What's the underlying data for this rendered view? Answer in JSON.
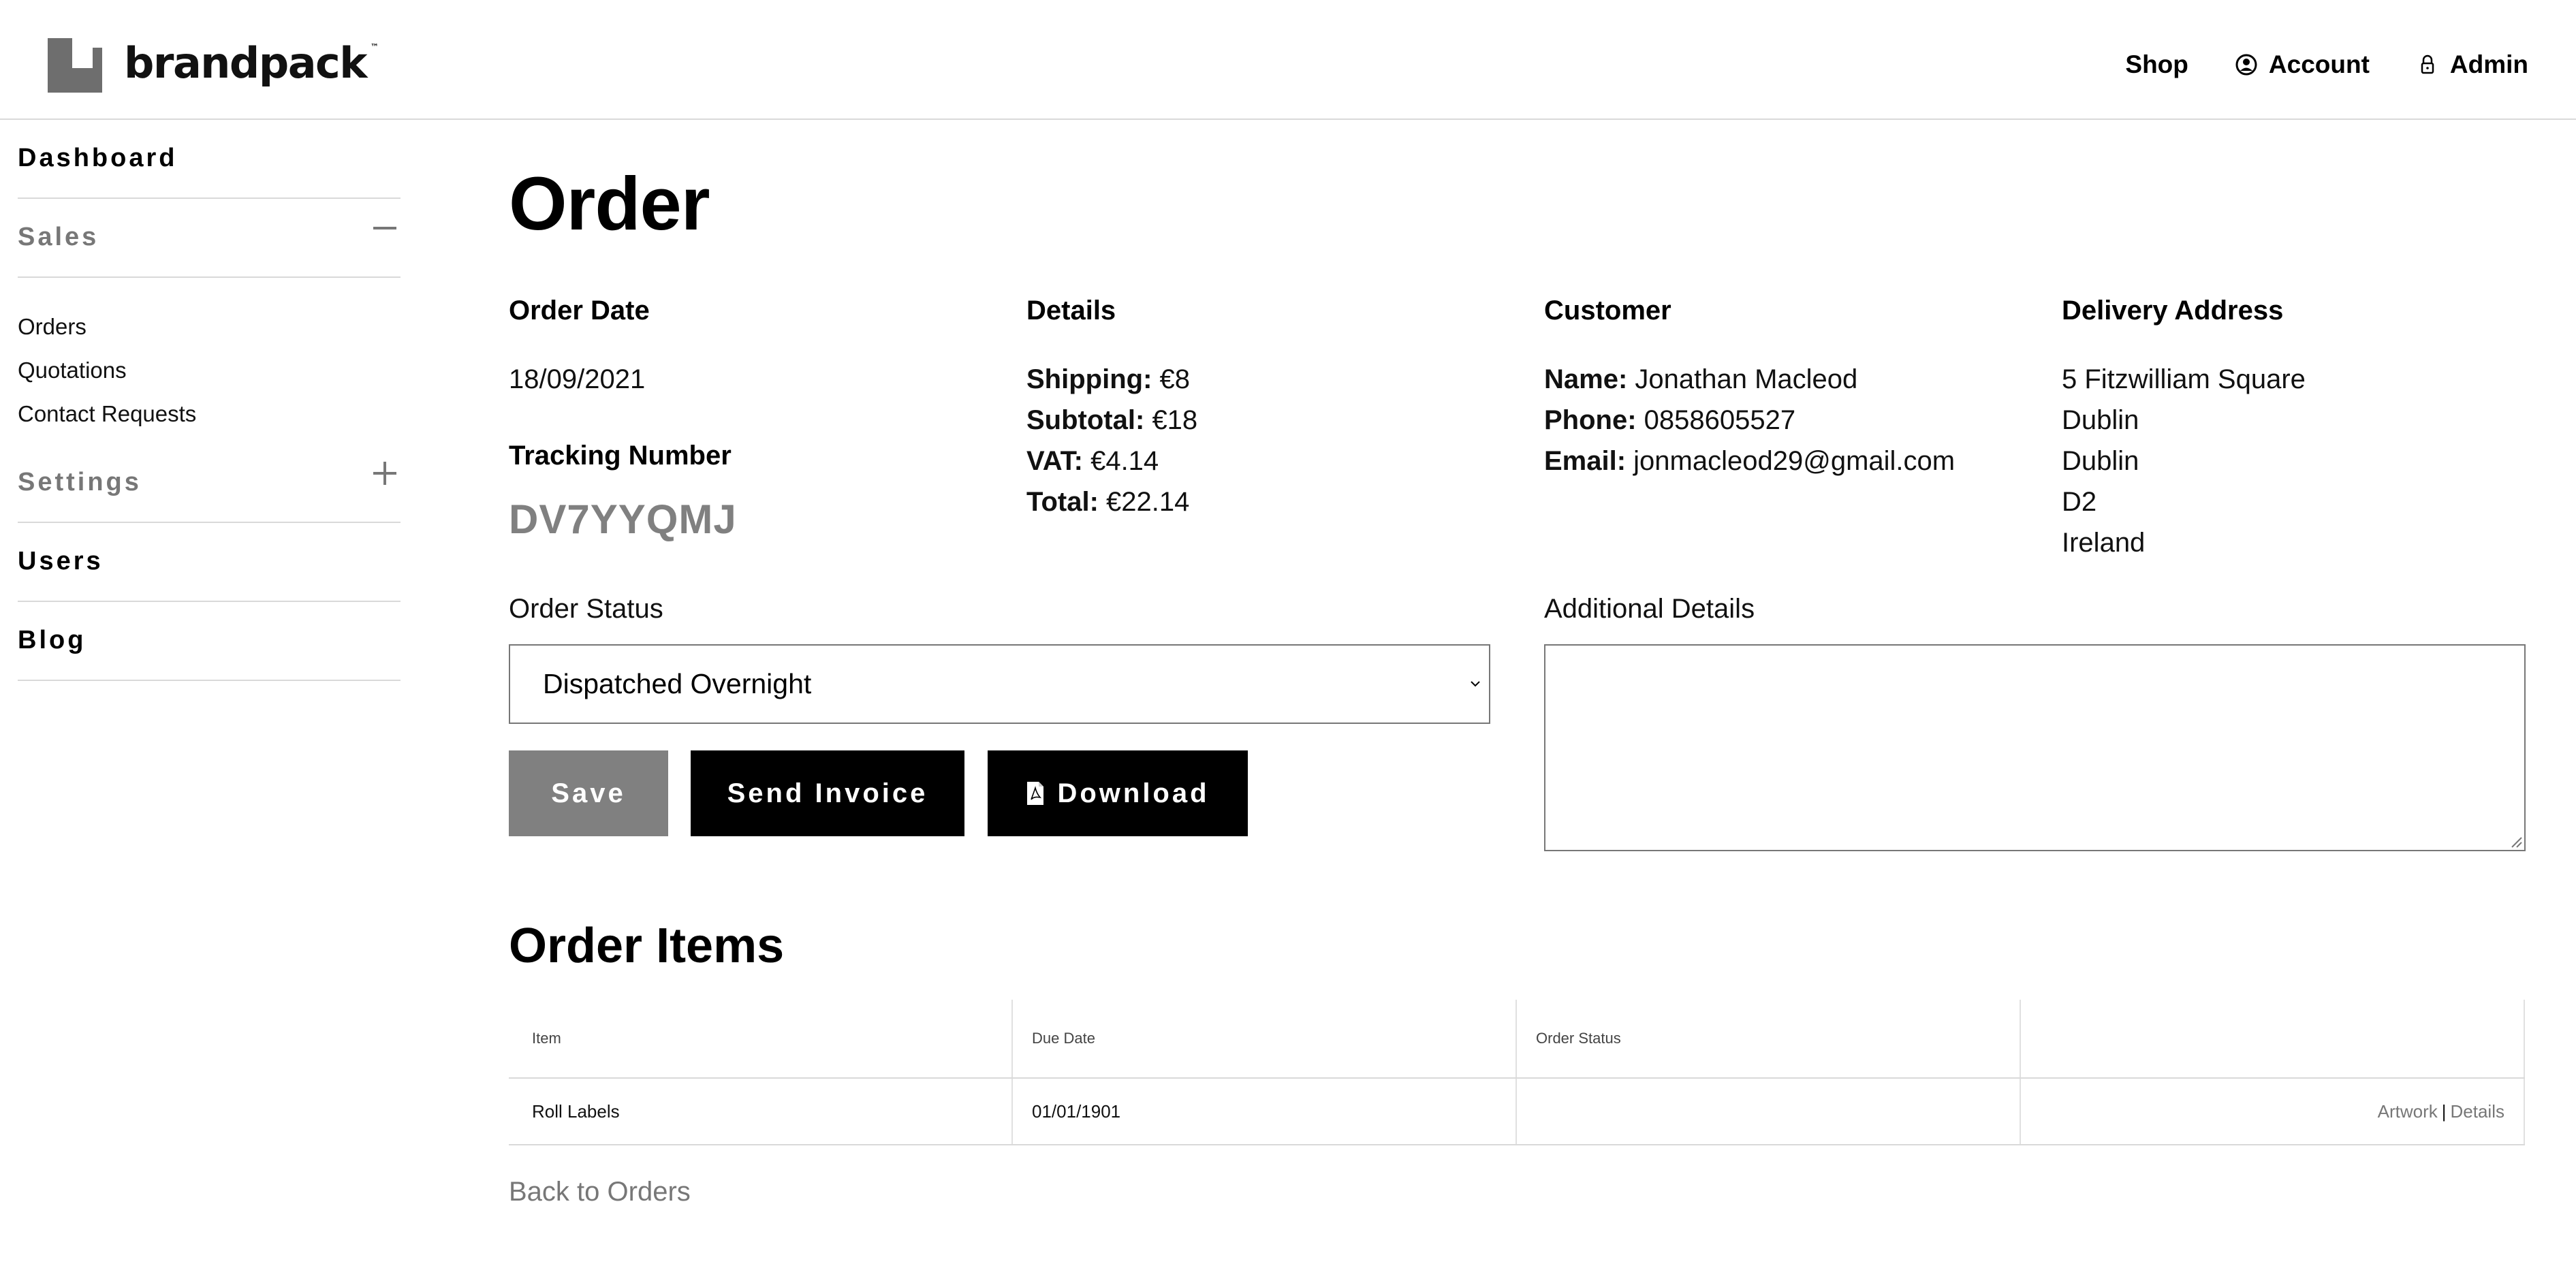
{
  "brand": {
    "name": "brandpack",
    "tm": "™"
  },
  "nav": {
    "shop": "Shop",
    "account": "Account",
    "admin": "Admin"
  },
  "sidebar": {
    "dashboard": "Dashboard",
    "sales": "Sales",
    "sales_items": [
      "Orders",
      "Quotations",
      "Contact Requests"
    ],
    "settings": "Settings",
    "users": "Users",
    "blog": "Blog"
  },
  "page": {
    "title": "Order"
  },
  "order_date": {
    "heading": "Order Date",
    "value": "18/09/2021"
  },
  "tracking": {
    "heading": "Tracking Number",
    "value": "DV7YYQMJ"
  },
  "details": {
    "heading": "Details",
    "shipping_label": "Shipping:",
    "shipping": "€8",
    "subtotal_label": "Subtotal:",
    "subtotal": "€18",
    "vat_label": "VAT:",
    "vat": "€4.14",
    "total_label": "Total:",
    "total": "€22.14"
  },
  "customer": {
    "heading": "Customer",
    "name_label": "Name:",
    "name": "Jonathan Macleod",
    "phone_label": "Phone:",
    "phone": "0858605527",
    "email_label": "Email:",
    "email": "jonmacleod29@gmail.com"
  },
  "delivery": {
    "heading": "Delivery Address",
    "lines": [
      "5 Fitzwilliam Square",
      "Dublin",
      "Dublin",
      "D2",
      "Ireland"
    ]
  },
  "order_status": {
    "label": "Order Status",
    "selected": "Dispatched Overnight"
  },
  "additional": {
    "label": "Additional Details",
    "value": ""
  },
  "buttons": {
    "save": "Save",
    "send_invoice": "Send Invoice",
    "download": "Download"
  },
  "items_section": {
    "title": "Order Items",
    "columns": [
      "Item",
      "Due Date",
      "Order Status",
      ""
    ],
    "rows": [
      {
        "item": "Roll Labels",
        "due_date": "01/01/1901",
        "status": "",
        "artwork": "Artwork",
        "sep": "|",
        "details": "Details"
      }
    ]
  },
  "back_link": "Back to Orders",
  "colors": {
    "muted": "#808080",
    "border": "#d9d9d9",
    "primary": "#000000"
  }
}
